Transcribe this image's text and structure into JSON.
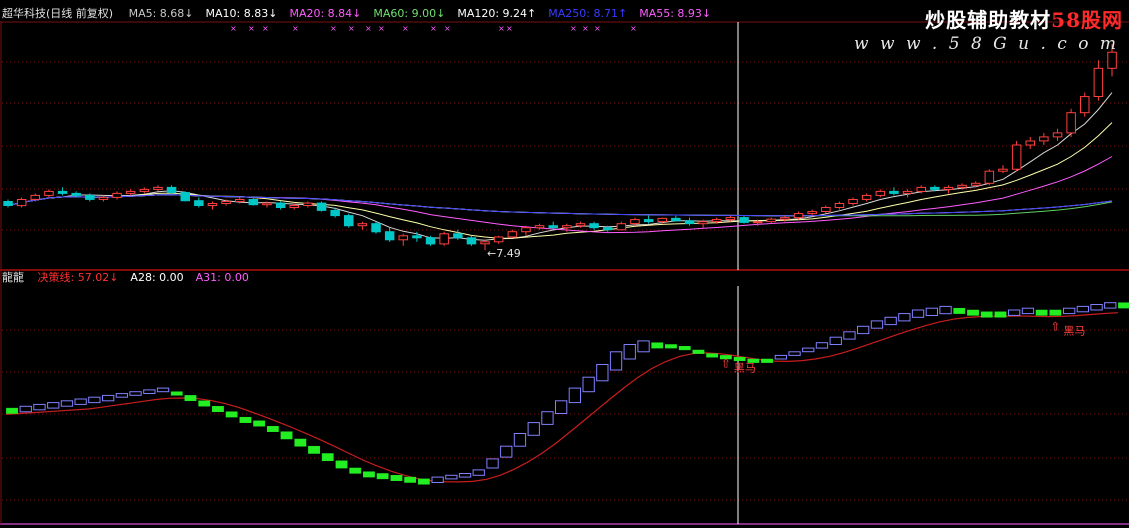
{
  "window": {
    "title": "超华科技(日线 前复权)"
  },
  "watermark": {
    "line1_pre": "炒股辅助教材",
    "line1_brand": "58股网",
    "line2": "w w w . 5 8 G u . c o m"
  },
  "main_panel": {
    "ma_labels": [
      {
        "name": "MA5",
        "value": "8.68",
        "arrow": "↓",
        "color": "#c9c9c9"
      },
      {
        "name": "MA10",
        "value": "8.83",
        "arrow": "↓",
        "color": "#ffffff"
      },
      {
        "name": "MA20",
        "value": "8.84",
        "arrow": "↓",
        "color": "#ff5cff"
      },
      {
        "name": "MA60",
        "value": "9.00",
        "arrow": "↓",
        "color": "#6ee06e"
      },
      {
        "name": "MA120",
        "value": "9.24",
        "arrow": "↑",
        "color": "#ffffff"
      },
      {
        "name": "MA250",
        "value": "8.71",
        "arrow": "↑",
        "color": "#3b3bff"
      },
      {
        "name": "MA55",
        "value": "8.93",
        "arrow": "↓",
        "color": "#ff5cff"
      }
    ],
    "low_marker": "←7.49"
  },
  "sub_panel": {
    "name": "龍龍",
    "indicators": [
      {
        "name": "决策线",
        "value": "57.02",
        "arrow": "↓",
        "color": "#ff3030"
      },
      {
        "name": "A28",
        "value": "0.00",
        "arrow": "",
        "color": "#ffffff"
      },
      {
        "name": "A31",
        "value": "0.00",
        "arrow": "",
        "color": "#ff5cff"
      }
    ],
    "signal_label": "黑马",
    "signals": [
      "黑马",
      "黑马"
    ]
  },
  "colors": {
    "up": "#ff4040",
    "down": "#00c8c8",
    "green_block": "#22ee22",
    "blue_block": "#8080ff",
    "red_line": "#c81e1e",
    "grid": "#7a1010",
    "crosshair": "#ffffff"
  },
  "chart_data": [
    {
      "type": "candlestick",
      "title": "",
      "series": [
        {
          "name": "MA5",
          "values": []
        },
        {
          "name": "MA10",
          "values": []
        },
        {
          "name": "MA20",
          "values": []
        },
        {
          "name": "MA60",
          "values": []
        },
        {
          "name": "MA120",
          "values": []
        },
        {
          "name": "MA250",
          "values": []
        }
      ],
      "ohlc": [
        [
          8.7,
          8.75,
          8.55,
          8.6
        ],
        [
          8.6,
          8.8,
          8.55,
          8.75
        ],
        [
          8.75,
          8.9,
          8.7,
          8.85
        ],
        [
          8.85,
          9.0,
          8.8,
          8.95
        ],
        [
          8.95,
          9.05,
          8.85,
          8.9
        ],
        [
          8.9,
          8.95,
          8.8,
          8.85
        ],
        [
          8.85,
          8.9,
          8.7,
          8.75
        ],
        [
          8.75,
          8.85,
          8.7,
          8.8
        ],
        [
          8.8,
          8.95,
          8.75,
          8.9
        ],
        [
          8.9,
          9.0,
          8.85,
          8.95
        ],
        [
          8.95,
          9.05,
          8.9,
          9.0
        ],
        [
          9.0,
          9.1,
          8.95,
          9.05
        ],
        [
          9.05,
          9.1,
          8.9,
          8.92
        ],
        [
          8.92,
          8.95,
          8.7,
          8.72
        ],
        [
          8.72,
          8.8,
          8.55,
          8.6
        ],
        [
          8.6,
          8.7,
          8.5,
          8.65
        ],
        [
          8.65,
          8.75,
          8.6,
          8.7
        ],
        [
          8.7,
          8.8,
          8.65,
          8.75
        ],
        [
          8.75,
          8.8,
          8.6,
          8.62
        ],
        [
          8.62,
          8.7,
          8.55,
          8.66
        ],
        [
          8.66,
          8.7,
          8.5,
          8.55
        ],
        [
          8.55,
          8.65,
          8.5,
          8.6
        ],
        [
          8.6,
          8.7,
          8.55,
          8.66
        ],
        [
          8.66,
          8.7,
          8.45,
          8.48
        ],
        [
          8.48,
          8.55,
          8.3,
          8.35
        ],
        [
          8.35,
          8.4,
          8.05,
          8.1
        ],
        [
          8.1,
          8.2,
          8.0,
          8.15
        ],
        [
          8.15,
          8.2,
          7.9,
          7.95
        ],
        [
          7.95,
          8.05,
          7.7,
          7.75
        ],
        [
          7.75,
          7.9,
          7.6,
          7.85
        ],
        [
          7.85,
          7.95,
          7.7,
          7.8
        ],
        [
          7.8,
          7.85,
          7.6,
          7.65
        ],
        [
          7.65,
          7.95,
          7.6,
          7.9
        ],
        [
          7.9,
          8.0,
          7.75,
          7.8
        ],
        [
          7.8,
          7.85,
          7.6,
          7.65
        ],
        [
          7.65,
          7.75,
          7.49,
          7.7
        ],
        [
          7.7,
          7.85,
          7.65,
          7.82
        ],
        [
          7.82,
          8.0,
          7.8,
          7.95
        ],
        [
          7.95,
          8.1,
          7.85,
          8.05
        ],
        [
          8.05,
          8.15,
          8.0,
          8.1
        ],
        [
          8.1,
          8.2,
          8.0,
          8.05
        ],
        [
          8.05,
          8.15,
          7.95,
          8.1
        ],
        [
          8.1,
          8.2,
          8.05,
          8.15
        ],
        [
          8.15,
          8.2,
          8.0,
          8.05
        ],
        [
          8.05,
          8.1,
          7.95,
          8.0
        ],
        [
          8.0,
          8.2,
          7.98,
          8.15
        ],
        [
          8.15,
          8.3,
          8.1,
          8.25
        ],
        [
          8.25,
          8.35,
          8.15,
          8.2
        ],
        [
          8.2,
          8.3,
          8.15,
          8.28
        ],
        [
          8.28,
          8.35,
          8.2,
          8.22
        ],
        [
          8.22,
          8.3,
          8.1,
          8.15
        ],
        [
          8.15,
          8.25,
          8.05,
          8.2
        ],
        [
          8.2,
          8.3,
          8.15,
          8.25
        ],
        [
          8.25,
          8.35,
          8.2,
          8.3
        ],
        [
          8.3,
          8.35,
          8.15,
          8.18
        ],
        [
          8.18,
          8.25,
          8.1,
          8.2
        ],
        [
          8.2,
          8.3,
          8.15,
          8.26
        ],
        [
          8.26,
          8.35,
          8.2,
          8.3
        ],
        [
          8.3,
          8.45,
          8.25,
          8.4
        ],
        [
          8.4,
          8.5,
          8.35,
          8.45
        ],
        [
          8.45,
          8.6,
          8.4,
          8.55
        ],
        [
          8.55,
          8.7,
          8.5,
          8.65
        ],
        [
          8.65,
          8.8,
          8.6,
          8.75
        ],
        [
          8.75,
          8.9,
          8.7,
          8.85
        ],
        [
          8.85,
          9.0,
          8.8,
          8.95
        ],
        [
          8.95,
          9.05,
          8.85,
          8.9
        ],
        [
          8.9,
          9.0,
          8.8,
          8.95
        ],
        [
          8.95,
          9.1,
          8.9,
          9.05
        ],
        [
          9.05,
          9.1,
          8.95,
          9.0
        ],
        [
          9.0,
          9.1,
          8.9,
          9.05
        ],
        [
          9.05,
          9.15,
          9.0,
          9.1
        ],
        [
          9.1,
          9.2,
          9.05,
          9.15
        ],
        [
          9.15,
          9.5,
          9.1,
          9.45
        ],
        [
          9.45,
          9.6,
          9.4,
          9.5
        ],
        [
          9.5,
          10.2,
          9.45,
          10.1
        ],
        [
          10.1,
          10.3,
          10.0,
          10.2
        ],
        [
          10.2,
          10.4,
          10.1,
          10.3
        ],
        [
          10.3,
          10.5,
          10.2,
          10.4
        ],
        [
          10.4,
          11.0,
          10.3,
          10.9
        ],
        [
          10.9,
          11.4,
          10.8,
          11.3
        ],
        [
          11.3,
          12.2,
          11.2,
          12.0
        ],
        [
          12.0,
          12.6,
          11.8,
          12.4
        ]
      ],
      "ylim": [
        7.2,
        13.0
      ]
    },
    {
      "type": "bar",
      "title": "",
      "series": [
        {
          "name": "决策线",
          "values": []
        }
      ],
      "blocks": [
        [
          52,
          55
        ],
        [
          53,
          56
        ],
        [
          54,
          57
        ],
        [
          55,
          58
        ],
        [
          56,
          59
        ],
        [
          57,
          60
        ],
        [
          58,
          61
        ],
        [
          59,
          62
        ],
        [
          61,
          63
        ],
        [
          62,
          64
        ],
        [
          63,
          65
        ],
        [
          64,
          66
        ],
        [
          62,
          64
        ],
        [
          59,
          62
        ],
        [
          56,
          59
        ],
        [
          53,
          56
        ],
        [
          50,
          53
        ],
        [
          47,
          50
        ],
        [
          45,
          48
        ],
        [
          42,
          45
        ],
        [
          38,
          42
        ],
        [
          34,
          38
        ],
        [
          30,
          34
        ],
        [
          26,
          30
        ],
        [
          22,
          26
        ],
        [
          19,
          22
        ],
        [
          17,
          20
        ],
        [
          16,
          19
        ],
        [
          15,
          18
        ],
        [
          14,
          17
        ],
        [
          13,
          16
        ],
        [
          14,
          17
        ],
        [
          16,
          18
        ],
        [
          17,
          19
        ],
        [
          18,
          21
        ],
        [
          22,
          27
        ],
        [
          28,
          34
        ],
        [
          34,
          41
        ],
        [
          40,
          47
        ],
        [
          46,
          53
        ],
        [
          52,
          59
        ],
        [
          58,
          66
        ],
        [
          64,
          72
        ],
        [
          70,
          79
        ],
        [
          76,
          86
        ],
        [
          82,
          90
        ],
        [
          86,
          92
        ],
        [
          88,
          91
        ],
        [
          88,
          90
        ],
        [
          87,
          89
        ],
        [
          85,
          87
        ],
        [
          83,
          85
        ],
        [
          82,
          84
        ],
        [
          81,
          83
        ],
        [
          80,
          82
        ],
        [
          80,
          82
        ],
        [
          82,
          84
        ],
        [
          84,
          86
        ],
        [
          86,
          88
        ],
        [
          88,
          91
        ],
        [
          90,
          94
        ],
        [
          93,
          97
        ],
        [
          96,
          100
        ],
        [
          99,
          103
        ],
        [
          101,
          105
        ],
        [
          103,
          107
        ],
        [
          105,
          109
        ],
        [
          106,
          110
        ],
        [
          107,
          111
        ],
        [
          107,
          110
        ],
        [
          106,
          109
        ],
        [
          105,
          108
        ],
        [
          105,
          108
        ],
        [
          106,
          109
        ],
        [
          107,
          110
        ],
        [
          106,
          109
        ],
        [
          106,
          109
        ],
        [
          107,
          110
        ],
        [
          108,
          111
        ],
        [
          109,
          112
        ],
        [
          110,
          113
        ],
        [
          110,
          113
        ]
      ],
      "ylim": [
        0,
        120
      ]
    }
  ]
}
